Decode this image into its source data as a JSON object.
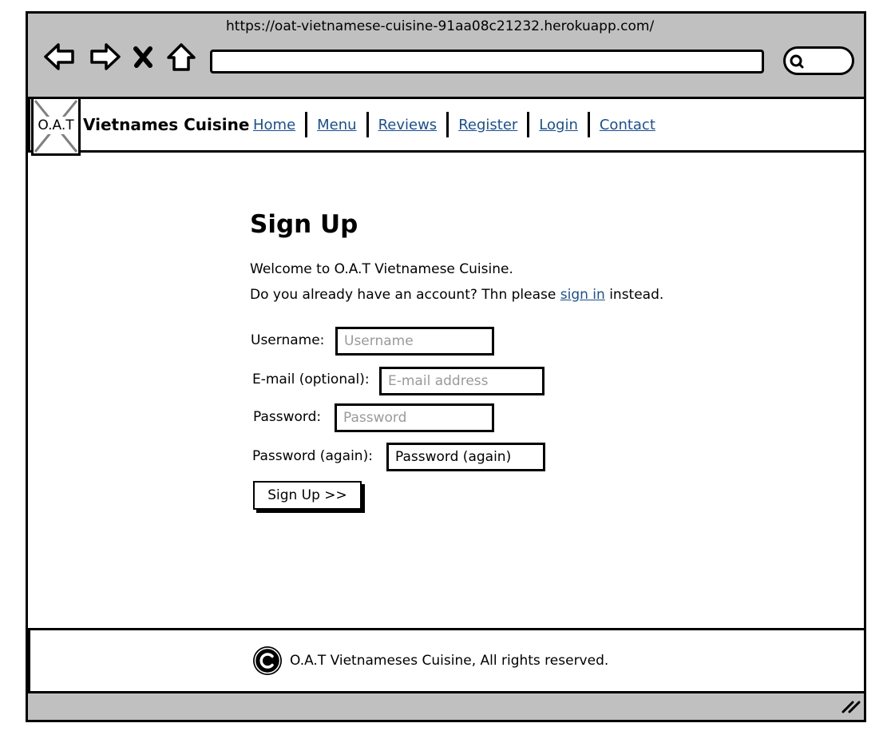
{
  "browser": {
    "url": "https://oat-vietnamese-cuisine-91aa08c21232.herokuapp.com/",
    "address_value": ""
  },
  "navbar": {
    "logo_label": "O.A.T",
    "brand": "Vietnames Cuisine",
    "links": [
      "Home",
      "Menu",
      "Reviews",
      "Register",
      "Login",
      "Contact"
    ]
  },
  "signup": {
    "title": "Sign Up",
    "welcome": "Welcome to O.A.T Vietnamese Cuisine.",
    "signin_prefix": "Do you already have an account? Thn please",
    "signin_link": "sign in",
    "signin_suffix": "instead.",
    "fields": {
      "username": {
        "label": "Username:",
        "placeholder": "Username",
        "value": ""
      },
      "email": {
        "label": "E-mail (optional):",
        "placeholder": "E-mail address",
        "value": ""
      },
      "password": {
        "label": "Password:",
        "placeholder": "Password",
        "value": ""
      },
      "password2": {
        "label": "Password (again):",
        "placeholder": "",
        "value": "Password (again)"
      }
    },
    "submit_label": "Sign Up >>"
  },
  "footer": {
    "text": "O.A.T Vietnameses Cuisine, All rights reserved."
  },
  "icons": {
    "back": "arrow-left-icon",
    "forward": "arrow-right-icon",
    "stop": "close-icon",
    "home": "home-icon",
    "search": "search-icon",
    "copyright": "copyright-icon",
    "resize": "resize-grip-icon"
  },
  "colors": {
    "link": "#1a4f8f",
    "chrome": "#c0c0c0",
    "placeholder": "#9a9a9a"
  }
}
